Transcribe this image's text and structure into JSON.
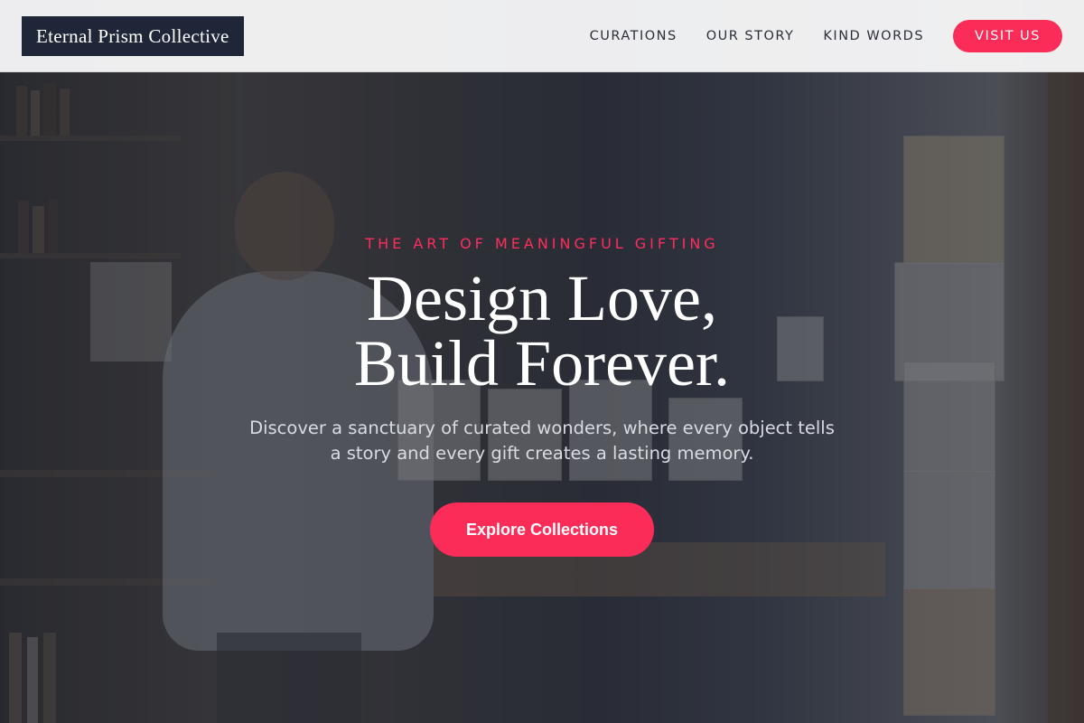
{
  "brand": {
    "name": "Eternal Prism Collective"
  },
  "nav": {
    "links": [
      "CURATIONS",
      "OUR STORY",
      "KIND WORDS"
    ],
    "cta_label": "VISIT US"
  },
  "hero": {
    "eyebrow": "THE ART OF MEANINGFUL GIFTING",
    "headline_line1": "Design Love,",
    "headline_line2": "Build Forever.",
    "subtext": "Discover a sanctuary of curated wonders, where every object tells a story and every gift creates a lasting memory.",
    "cta_label": "Explore Collections",
    "background_image": "bookshop-woman-browsing-photo"
  },
  "colors": {
    "accent": "#fb2c57",
    "brand_bg": "#1f2638",
    "nav_bg": "#f6f6f7",
    "overlay": "#1e2230"
  }
}
